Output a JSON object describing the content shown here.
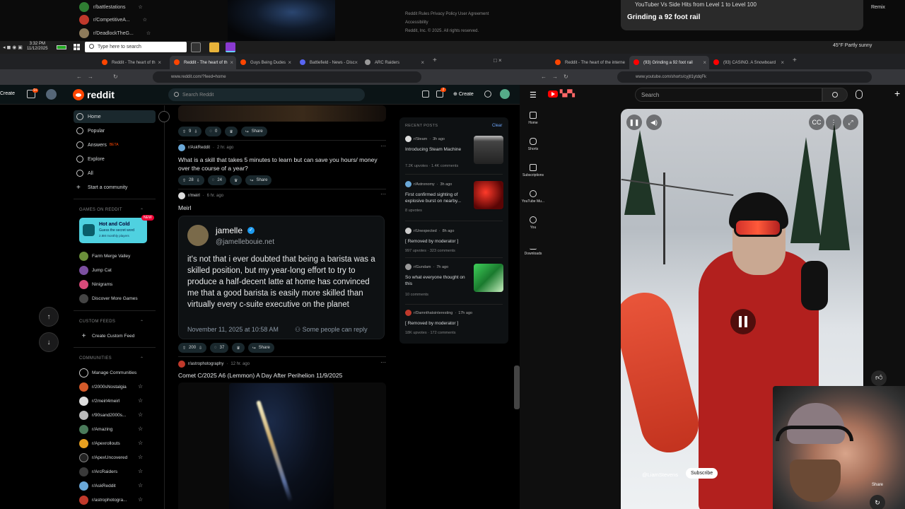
{
  "background_window": {
    "subreddits": [
      {
        "name": "r/battlestations",
        "color": "#2f7d32"
      },
      {
        "name": "r/CompetitiveA...",
        "color": "#c0392b"
      },
      {
        "name": "r/DeadlockTheG...",
        "color": "#8d7a5a"
      }
    ],
    "footer": [
      "Reddit Rules  Privacy Policy  User Agreement",
      "Accessibility",
      "Reddit, Inc. © 2025. All rights reserved."
    ],
    "yt_card_title": "YouTuber Vs Side Hits from Level 1 to Level 100",
    "yt_card_subtitle": "Grinding a 92 foot rail",
    "remix_label": "Remix"
  },
  "taskbar": {
    "time": "3:32 PM",
    "date": "11/12/2025",
    "search_placeholder": "Type here to search",
    "weather": "45°F  Partly sunny"
  },
  "left_browser": {
    "tabs": [
      {
        "label": "Reddit - The heart of th",
        "active": false
      },
      {
        "label": "Reddit - The heart of th",
        "active": true
      },
      {
        "label": "Guys Being Dudes",
        "active": false
      },
      {
        "label": "Battlefield - News - Disc",
        "active": false
      },
      {
        "label": "ARC Raiders",
        "active": false
      }
    ],
    "url": "www.reddit.com/?feed=home"
  },
  "reddit": {
    "logo_text": "reddit",
    "search_placeholder": "Search Reddit",
    "create_label": "Create",
    "notifications_badge": "9+",
    "chat_badge": "2",
    "nav": [
      {
        "label": "Home",
        "icon": "home-icon",
        "active": true
      },
      {
        "label": "Popular",
        "icon": "popular-icon"
      },
      {
        "label": "Answers",
        "icon": "answers-icon",
        "tag": "BETA"
      },
      {
        "label": "Explore",
        "icon": "explore-icon"
      },
      {
        "label": "All",
        "icon": "all-icon"
      },
      {
        "label": "Start a community",
        "icon": "plus-icon"
      }
    ],
    "games_heading": "GAMES ON REDDIT",
    "game_card": {
      "title": "Hot and Cold",
      "subtitle": "Guess the secret word",
      "plays": "2.8M monthly players",
      "badge": "NEW"
    },
    "games": [
      {
        "label": "Farm Merge Valley",
        "color": "#6a8f3a"
      },
      {
        "label": "Jump Cat",
        "color": "#7b4fa0"
      },
      {
        "label": "Ninigrams",
        "color": "#d94a7a"
      },
      {
        "label": "Discover More Games",
        "color": "#444"
      }
    ],
    "custom_feeds_heading": "CUSTOM FEEDS",
    "create_custom_feed": "Create Custom Feed",
    "communities_heading": "COMMUNITIES",
    "manage_communities": "Manage Communities",
    "communities": [
      {
        "name": "r/2000sNostalgia",
        "color": "#d45a2a"
      },
      {
        "name": "r/2meirl4meirl",
        "color": "#dddddd"
      },
      {
        "name": "r/90sand2000s...",
        "color": "#bbbbbb"
      },
      {
        "name": "r/Amazing",
        "color": "#4a7a5a"
      },
      {
        "name": "r/Apexrollouts",
        "color": "#e8a020"
      },
      {
        "name": "r/ApexUncovered",
        "color": "#222222"
      },
      {
        "name": "r/ArcRaiders",
        "color": "#3a3a3a"
      },
      {
        "name": "r/AskReddit",
        "color": "#6aa8d8"
      },
      {
        "name": "r/astrophotogra...",
        "color": "#c0392b"
      }
    ],
    "feed": {
      "post0_actions": {
        "votes": "9",
        "comments": "0",
        "share": "Share"
      },
      "post1": {
        "sub": "r/AskReddit",
        "time": "2 hr. ago",
        "title": "What is a skill that takes 5 minutes to learn but can save you hours/ money over the course of a year?",
        "votes": "28",
        "comments": "24",
        "share": "Share"
      },
      "post2": {
        "sub": "r/meirl",
        "time": "6 hr. ago",
        "title": "Meirl",
        "tweet_name": "jamelle",
        "tweet_handle": "@jamellebouie.net",
        "tweet_text": "it's not that i ever doubted that being a barista was a skilled position, but my year-long effort to try to produce a half-decent latte at home has convinced me that a good barista is easily more skilled than virtually every c-suite executive on the planet",
        "tweet_date": "November 11, 2025 at 10:58 AM",
        "tweet_reply": "Some people can reply",
        "votes": "200",
        "comments": "37",
        "share": "Share"
      },
      "post3": {
        "sub": "r/astrophotography",
        "time": "12 hr. ago",
        "title": "Comet C/2025 A6 (Lemmon) A Day After Perihelion 11/9/2025"
      }
    },
    "recent": {
      "heading": "RECENT POSTS",
      "clear": "Clear",
      "items": [
        {
          "sub": "r/Steam",
          "time": "3h ago",
          "title": "Introducing Steam Machine",
          "stats": "7.2K upvotes · 1.4K comments",
          "thumb": "#555"
        },
        {
          "sub": "r/Astronomy",
          "time": "3h ago",
          "title": "First confirmed sighting of explosive burst on nearby...",
          "stats": "8 upvotes",
          "thumb": "#b01010"
        },
        {
          "sub": "r/Unexpected",
          "time": "8h ago",
          "title": "[ Removed by moderator ]",
          "stats": "997 upvotes · 323 comments",
          "thumb": ""
        },
        {
          "sub": "r/Gundam",
          "time": "7h ago",
          "title": "So what everyone thought on this",
          "stats": "10 comments",
          "thumb": "#2fae4a"
        },
        {
          "sub": "r/Damnthatsinteresting",
          "time": "17h ago",
          "title": "[ Removed by moderator ]",
          "stats": "18K upvotes · 172 comments",
          "thumb": ""
        }
      ]
    }
  },
  "right_browser": {
    "tabs": [
      {
        "label": "Reddit - The heart of the interne",
        "active": false
      },
      {
        "label": "(93) Grinding a 92 foot rail",
        "active": true
      },
      {
        "label": "(93) CASINO. A Snowboard",
        "active": false
      }
    ],
    "url": "www.youtube.com/shorts/cyjtl1ytdqFk"
  },
  "youtube": {
    "search_placeholder": "Search",
    "nav": [
      {
        "label": "Home",
        "icon": "home-icon"
      },
      {
        "label": "Shorts",
        "icon": "shorts-icon"
      },
      {
        "label": "Subscriptions",
        "icon": "subscriptions-icon"
      },
      {
        "label": "YouTube Mu...",
        "icon": "music-icon"
      },
      {
        "label": "You",
        "icon": "you-icon"
      },
      {
        "label": "Downloads",
        "icon": "downloads-icon"
      }
    ],
    "channel": "@LiamStevens",
    "subscribe_label": "Subscribe",
    "share_label": "Share"
  }
}
